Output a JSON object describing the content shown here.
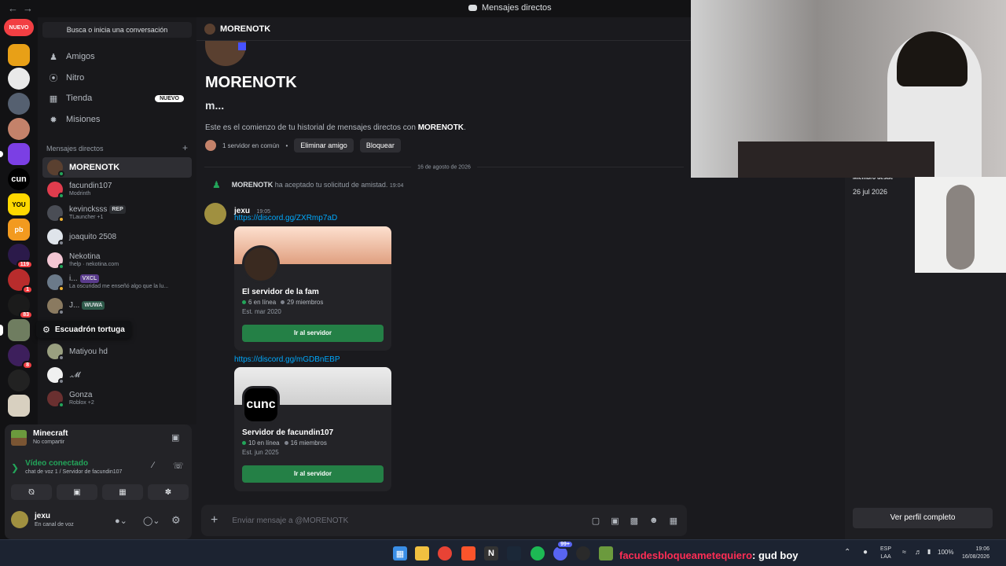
{
  "app": {
    "window_title": "Mensajes directos"
  },
  "rail": {
    "new_label": "NUEVO",
    "badges": [
      "119",
      "1",
      "83",
      "8"
    ],
    "tooltip": "Escuadrón tortuga"
  },
  "sidebar": {
    "search_placeholder": "Busca o inicia una conversación",
    "nav": [
      {
        "label": "Amigos",
        "icon": "friends-icon"
      },
      {
        "label": "Nitro",
        "icon": "nitro-icon"
      },
      {
        "label": "Tienda",
        "icon": "shop-icon",
        "badge": "NUEVO"
      },
      {
        "label": "Misiones",
        "icon": "quests-icon"
      }
    ],
    "dm_header": "Mensajes directos",
    "dm_add": "+",
    "dms": [
      {
        "name": "MORENOTK",
        "sub": "",
        "tag": ""
      },
      {
        "name": "facundin107",
        "sub": "Modrinth",
        "tag": ""
      },
      {
        "name": "kevincksss",
        "sub": "TLauncher +1",
        "tag": "REP"
      },
      {
        "name": "joaquito 2508",
        "sub": "",
        "tag": ""
      },
      {
        "name": "Nekotina",
        "sub": "!help · nekotina.com",
        "tag": ""
      },
      {
        "name": "i...",
        "sub": "La oscuridad me enseñó algo que la lu...",
        "tag": "VXCL"
      },
      {
        "name": "J...",
        "sub": "",
        "tag": "WUWA"
      },
      {
        "name": "Matiyou hd",
        "sub": "",
        "tag": ""
      },
      {
        "name": ".𝓜",
        "sub": "",
        "tag": ""
      },
      {
        "name": "Gonza",
        "sub": "Roblox +2",
        "tag": ""
      }
    ]
  },
  "panel": {
    "game_title": "Minecraft",
    "game_sub": "No compartir",
    "voice_status": "Vídeo conectado",
    "voice_channel": "chat de voz 1 / Servidor de facundin107",
    "user_name": "jexu",
    "user_status": "En canal de voz"
  },
  "chat": {
    "header_name": "MORENOTK",
    "big_name": "MORENOTK",
    "tagline": "m...",
    "intro_prefix": "Este es el comienzo de tu historial de mensajes directos con",
    "intro_name": "MORENOTK",
    "mutual": "1 servidor en común",
    "remove_friend": "Eliminar amigo",
    "block": "Bloquear",
    "date_divider": "16 de agosto de 2026",
    "system_name": "MORENOTK",
    "system_text": "ha aceptado tu solicitud de amistad.",
    "system_time": "19:04",
    "msg_author": "jexu",
    "msg_time": "19:05",
    "invites": [
      {
        "link": "https://discord.gg/ZXRmp7aD",
        "server": "El servidor de la fam",
        "online": "6 en línea",
        "members": "29 miembros",
        "est": "Est. mar 2020",
        "join": "Ir al servidor"
      },
      {
        "link": "https://discord.gg/mGDBnEBP",
        "server": "Servidor de facundin107",
        "online": "10 en línea",
        "members": "16 miembros",
        "est": "Est. jun 2025",
        "join": "Ir al servidor",
        "icon_text": "cunc"
      }
    ],
    "composer_placeholder": "Enviar mensaje a @MORENOTK"
  },
  "profile": {
    "member_since_label": "Miembro desde",
    "member_since": "26 jul 2026",
    "view_full": "Ver perfil completo"
  },
  "taskbar": {
    "overlay_user": "facudesbloqueametequiero",
    "overlay_text": ": gud boy",
    "lang": "ESP",
    "lang2": "LAA",
    "battery": "100%",
    "time": "19:06",
    "date": "16/08/2026",
    "discord_badge": "99+"
  },
  "colors": {
    "accent_green": "#248046",
    "online": "#23a55a",
    "link": "#00a8fc",
    "danger": "#f23f43"
  }
}
